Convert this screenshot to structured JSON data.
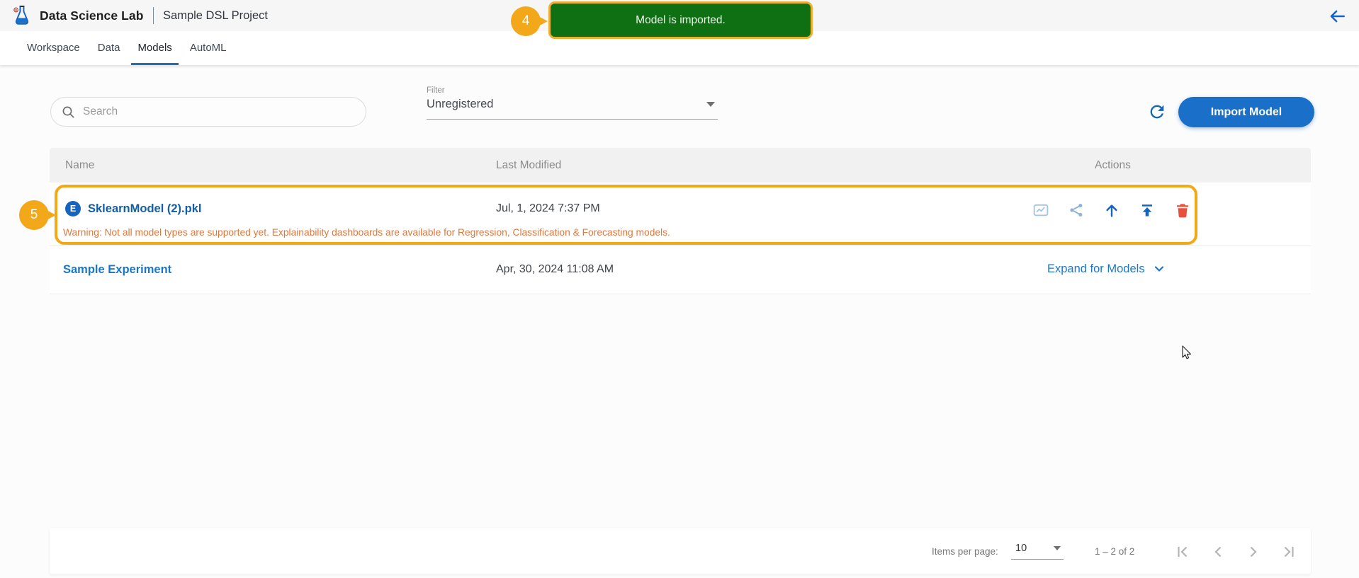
{
  "colors": {
    "accent_blue": "#1a70c8",
    "link_blue": "#1f77c0",
    "model_link_blue": "#135fa5",
    "toast_green": "#0e6f13",
    "toast_border": "#eeb02f",
    "annotation_orange": "#f2a818",
    "warning_orange": "#e0773c",
    "danger_red": "#e8503d",
    "nav_underline": "#2471ad",
    "icon_blue": "#1565c0",
    "icon_muted_blue": "#8fb4d8"
  },
  "header": {
    "app_title": "Data Science Lab",
    "project_name": "Sample DSL Project"
  },
  "nav": {
    "tabs": [
      {
        "label": "Workspace"
      },
      {
        "label": "Data"
      },
      {
        "label": "Models",
        "active": true
      },
      {
        "label": "AutoML"
      }
    ]
  },
  "toast": {
    "message": "Model is imported.",
    "step": "4"
  },
  "toolbar": {
    "search_placeholder": "Search",
    "filter_label": "Filter",
    "filter_value": "Unregistered",
    "import_button_label": "Import Model"
  },
  "table": {
    "columns": {
      "name": "Name",
      "last_modified": "Last Modified",
      "actions": "Actions"
    },
    "rows": [
      {
        "icon_letter": "E",
        "name": "SklearnModel (2).pkl",
        "last_modified": "Jul, 1, 2024 7:37 PM",
        "warning": "Warning: Not all model types are supported yet. Explainability dashboards are available for Regression, Classification & Forecasting models.",
        "step": "5"
      },
      {
        "name": "Sample Experiment",
        "last_modified": "Apr, 30, 2024 11:08 AM",
        "expand_label": "Expand for Models"
      }
    ]
  },
  "pagination": {
    "items_per_page_label": "Items per page:",
    "items_per_page_value": "10",
    "range_label": "1 – 2 of 2"
  }
}
